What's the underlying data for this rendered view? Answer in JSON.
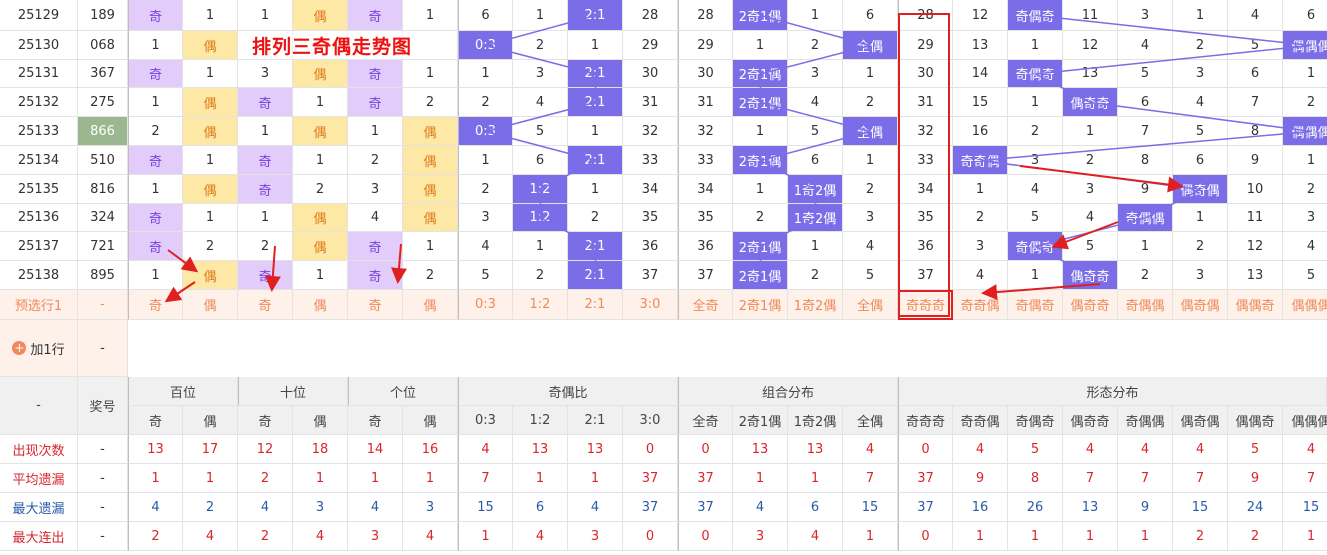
{
  "title": "排列三奇偶走势图",
  "add_row_label": "加1行",
  "rows": [
    {
      "issue": "25129",
      "num": "189",
      "hp": "奇",
      "he": "1",
      "sp": "1",
      "se": "偶",
      "gp": "奇",
      "ge": "1",
      "r03": "6",
      "r12": "1",
      "r21": "2:1",
      "r30": "28",
      "qj": "28",
      "z2j": "2奇1偶",
      "z1j": "1",
      "qo": "6",
      "jjj": "28",
      "jjo": "12",
      "joj": "奇偶奇",
      "ojj": "11",
      "jo2": "3",
      "ooj2": "1",
      "ooj": "4",
      "ooo": "6"
    },
    {
      "issue": "25130",
      "num": "068",
      "hp": "1",
      "he": "偶",
      "sp": "",
      "se": "",
      "gp": "",
      "ge": "",
      "r03": "0:3",
      "r12": "2",
      "r21": "1",
      "r30": "29",
      "qj": "29",
      "z2j": "1",
      "z1j": "2",
      "qo": "全偶",
      "jjj": "29",
      "jjo": "13",
      "joj": "1",
      "ojj": "12",
      "jo2": "4",
      "ooj2": "2",
      "ooj": "5",
      "ooo": "偶偶偶"
    },
    {
      "issue": "25131",
      "num": "367",
      "hp": "奇",
      "he": "1",
      "sp": "3",
      "se": "偶",
      "gp": "奇",
      "ge": "1",
      "r03": "1",
      "r12": "3",
      "r21": "2:1",
      "r30": "30",
      "qj": "30",
      "z2j": "2奇1偶",
      "z1j": "3",
      "qo": "1",
      "jjj": "30",
      "jjo": "14",
      "joj": "奇偶奇",
      "ojj": "13",
      "jo2": "5",
      "ooj2": "3",
      "ooj": "6",
      "ooo": "1"
    },
    {
      "issue": "25132",
      "num": "275",
      "hp": "1",
      "he": "偶",
      "sp": "奇",
      "se": "1",
      "gp": "奇",
      "ge": "2",
      "r03": "2",
      "r12": "4",
      "r21": "2:1",
      "r30": "31",
      "qj": "31",
      "z2j": "2奇1偶",
      "z1j": "4",
      "qo": "2",
      "jjj": "31",
      "jjo": "15",
      "joj": "1",
      "ojj": "偶奇奇",
      "jo2": "6",
      "ooj2": "4",
      "ooj": "7",
      "ooo": "2"
    },
    {
      "issue": "25133",
      "num": "866",
      "hp": "2",
      "he": "偶",
      "sp": "1",
      "se": "偶",
      "gp": "1",
      "ge": "偶",
      "r03": "0:3",
      "r12": "5",
      "r21": "1",
      "r30": "32",
      "qj": "32",
      "z2j": "1",
      "z1j": "5",
      "qo": "全偶",
      "jjj": "32",
      "jjo": "16",
      "joj": "2",
      "ojj": "1",
      "jo2": "7",
      "ooj2": "5",
      "ooj": "8",
      "ooo": "偶偶偶"
    },
    {
      "issue": "25134",
      "num": "510",
      "hp": "奇",
      "he": "1",
      "sp": "奇",
      "se": "1",
      "gp": "2",
      "ge": "偶",
      "r03": "1",
      "r12": "6",
      "r21": "2:1",
      "r30": "33",
      "qj": "33",
      "z2j": "2奇1偶",
      "z1j": "6",
      "qo": "1",
      "jjj": "33",
      "jjo": "奇奇偶",
      "joj": "3",
      "ojj": "2",
      "jo2": "8",
      "ooj2": "6",
      "ooj": "9",
      "ooo": "1"
    },
    {
      "issue": "25135",
      "num": "816",
      "hp": "1",
      "he": "偶",
      "sp": "奇",
      "se": "2",
      "gp": "3",
      "ge": "偶",
      "r03": "2",
      "r12": "1:2",
      "r21": "1",
      "r30": "34",
      "qj": "34",
      "z2j": "1",
      "z1j": "1奇2偶",
      "qo": "2",
      "jjj": "34",
      "jjo": "1",
      "joj": "4",
      "ojj": "3",
      "jo2": "9",
      "ooj2": "偶奇偶",
      "ooj": "10",
      "ooo": "2"
    },
    {
      "issue": "25136",
      "num": "324",
      "hp": "奇",
      "he": "1",
      "sp": "1",
      "se": "偶",
      "gp": "4",
      "ge": "偶",
      "r03": "3",
      "r12": "1:2",
      "r21": "2",
      "r30": "35",
      "qj": "35",
      "z2j": "2",
      "z1j": "1奇2偶",
      "qo": "3",
      "jjj": "35",
      "jjo": "2",
      "joj": "5",
      "ojj": "4",
      "jo2": "奇偶偶",
      "ooj2": "1",
      "ooj": "11",
      "ooo": "3"
    },
    {
      "issue": "25137",
      "num": "721",
      "hp": "奇",
      "he": "2",
      "sp": "2",
      "se": "偶",
      "gp": "奇",
      "ge": "1",
      "r03": "4",
      "r12": "1",
      "r21": "2:1",
      "r30": "36",
      "qj": "36",
      "z2j": "2奇1偶",
      "z1j": "1",
      "qo": "4",
      "jjj": "36",
      "jjo": "3",
      "joj": "奇偶奇",
      "ojj": "5",
      "jo2": "1",
      "ooj2": "2",
      "ooj": "12",
      "ooo": "4"
    },
    {
      "issue": "25138",
      "num": "895",
      "hp": "1",
      "he": "偶",
      "sp": "奇",
      "se": "1",
      "gp": "奇",
      "ge": "2",
      "r03": "5",
      "r12": "2",
      "r21": "2:1",
      "r30": "37",
      "qj": "37",
      "z2j": "2奇1偶",
      "z1j": "2",
      "qo": "5",
      "jjj": "37",
      "jjo": "4",
      "joj": "1",
      "ojj": "偶奇奇",
      "jo2": "2",
      "ooj2": "3",
      "ooj": "13",
      "ooo": "5"
    }
  ],
  "preselect": [
    "预选行1",
    "-",
    "奇",
    "偶",
    "奇",
    "偶",
    "奇",
    "偶",
    "0:3",
    "1:2",
    "2:1",
    "3:0",
    "全奇",
    "2奇1偶",
    "1奇2偶",
    "全偶",
    "奇奇奇",
    "奇奇偶",
    "奇偶奇",
    "偶奇奇",
    "奇偶偶",
    "偶奇偶",
    "偶偶奇",
    "偶偶偶"
  ],
  "header": {
    "dash": "-",
    "prize": "奖号",
    "groups": [
      "百位",
      "十位",
      "个位",
      "奇偶比",
      "组合分布",
      "形态分布"
    ],
    "sub": [
      "奇",
      "偶",
      "奇",
      "偶",
      "奇",
      "偶",
      "0:3",
      "1:2",
      "2:1",
      "3:0",
      "全奇",
      "2奇1偶",
      "1奇2偶",
      "全偶",
      "奇奇奇",
      "奇奇偶",
      "奇偶奇",
      "偶奇奇",
      "奇偶偶",
      "偶奇偶",
      "偶偶奇",
      "偶偶偶"
    ]
  },
  "stats": [
    {
      "label": "出现次数",
      "dash": "-",
      "vals": [
        "13",
        "17",
        "12",
        "18",
        "14",
        "16",
        "4",
        "13",
        "13",
        "0",
        "0",
        "13",
        "13",
        "4",
        "0",
        "4",
        "5",
        "4",
        "4",
        "4",
        "5",
        "4"
      ]
    },
    {
      "label": "平均遗漏",
      "dash": "-",
      "vals": [
        "1",
        "1",
        "2",
        "1",
        "1",
        "1",
        "7",
        "1",
        "1",
        "37",
        "37",
        "1",
        "1",
        "7",
        "37",
        "9",
        "8",
        "7",
        "7",
        "7",
        "9",
        "7"
      ]
    },
    {
      "label": "最大遗漏",
      "dash": "-",
      "vals": [
        "4",
        "2",
        "4",
        "3",
        "4",
        "3",
        "15",
        "6",
        "4",
        "37",
        "37",
        "4",
        "6",
        "15",
        "37",
        "16",
        "26",
        "13",
        "9",
        "15",
        "24",
        "15"
      ]
    },
    {
      "label": "最大连出",
      "dash": "-",
      "vals": [
        "2",
        "4",
        "2",
        "4",
        "3",
        "4",
        "1",
        "4",
        "3",
        "0",
        "0",
        "3",
        "4",
        "1",
        "0",
        "1",
        "1",
        "1",
        "1",
        "2",
        "2",
        "1"
      ]
    }
  ],
  "colors": {
    "odd": "#e2cdfa",
    "even": "#fde8a6",
    "hit": "#7b6ce8",
    "highlight": "#9ab78f",
    "arrow": "#e02020"
  }
}
